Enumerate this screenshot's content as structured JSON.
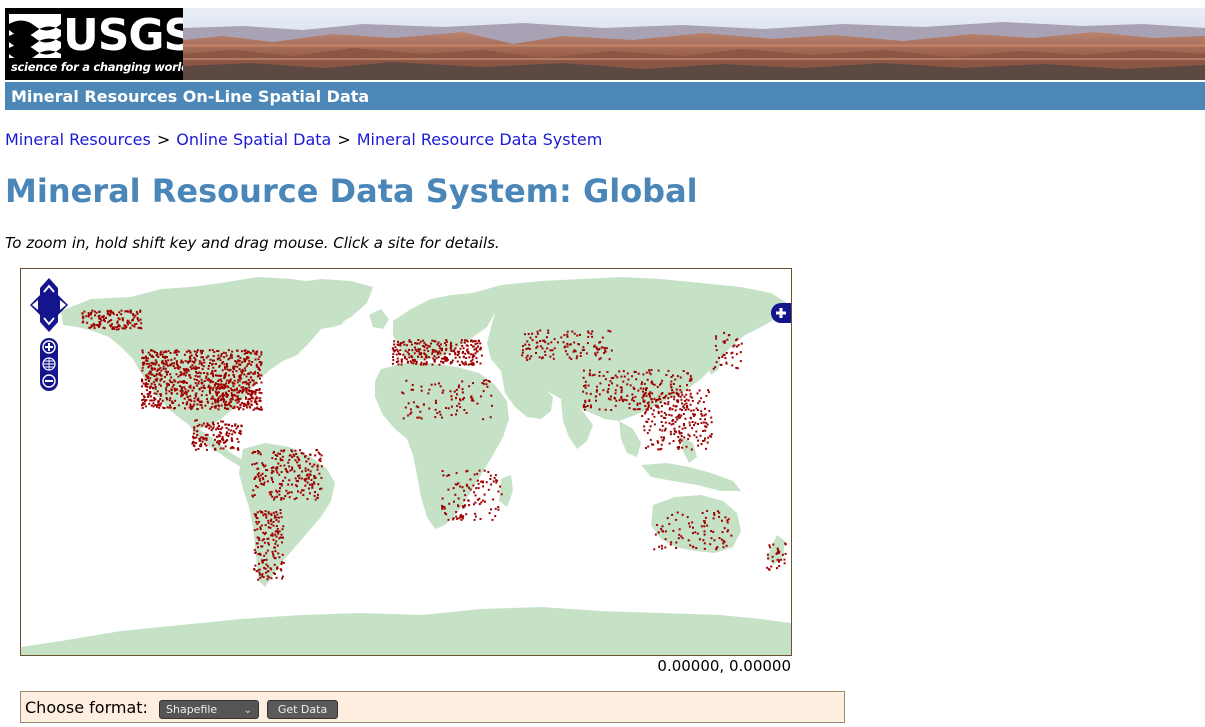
{
  "header": {
    "logo_text": "USGS",
    "logo_tagline": "science for a changing world",
    "site_title": "Mineral Resources On-Line Spatial Data"
  },
  "breadcrumb": [
    {
      "label": "Mineral Resources"
    },
    {
      "label": "Online Spatial Data"
    },
    {
      "label": "Mineral Resource Data System"
    }
  ],
  "breadcrumb_separator": ">",
  "page_title": "Mineral Resource Data System: Global",
  "instructions": "To zoom in, hold shift key and drag mouse. Click a site for details.",
  "map": {
    "land_color": "#c5e2c7",
    "site_color": "#9e0000",
    "controls_color": "#14148c",
    "icons": [
      "pan-up-icon",
      "pan-left-icon",
      "pan-right-icon",
      "pan-down-icon",
      "zoom-in-icon",
      "zoom-world-icon",
      "zoom-out-icon",
      "layer-switcher-plus-icon"
    ]
  },
  "coordinates": "0.00000, 0.00000",
  "download": {
    "label": "Choose format:",
    "format_selected": "Shapefile",
    "button_label": "Get Data"
  }
}
